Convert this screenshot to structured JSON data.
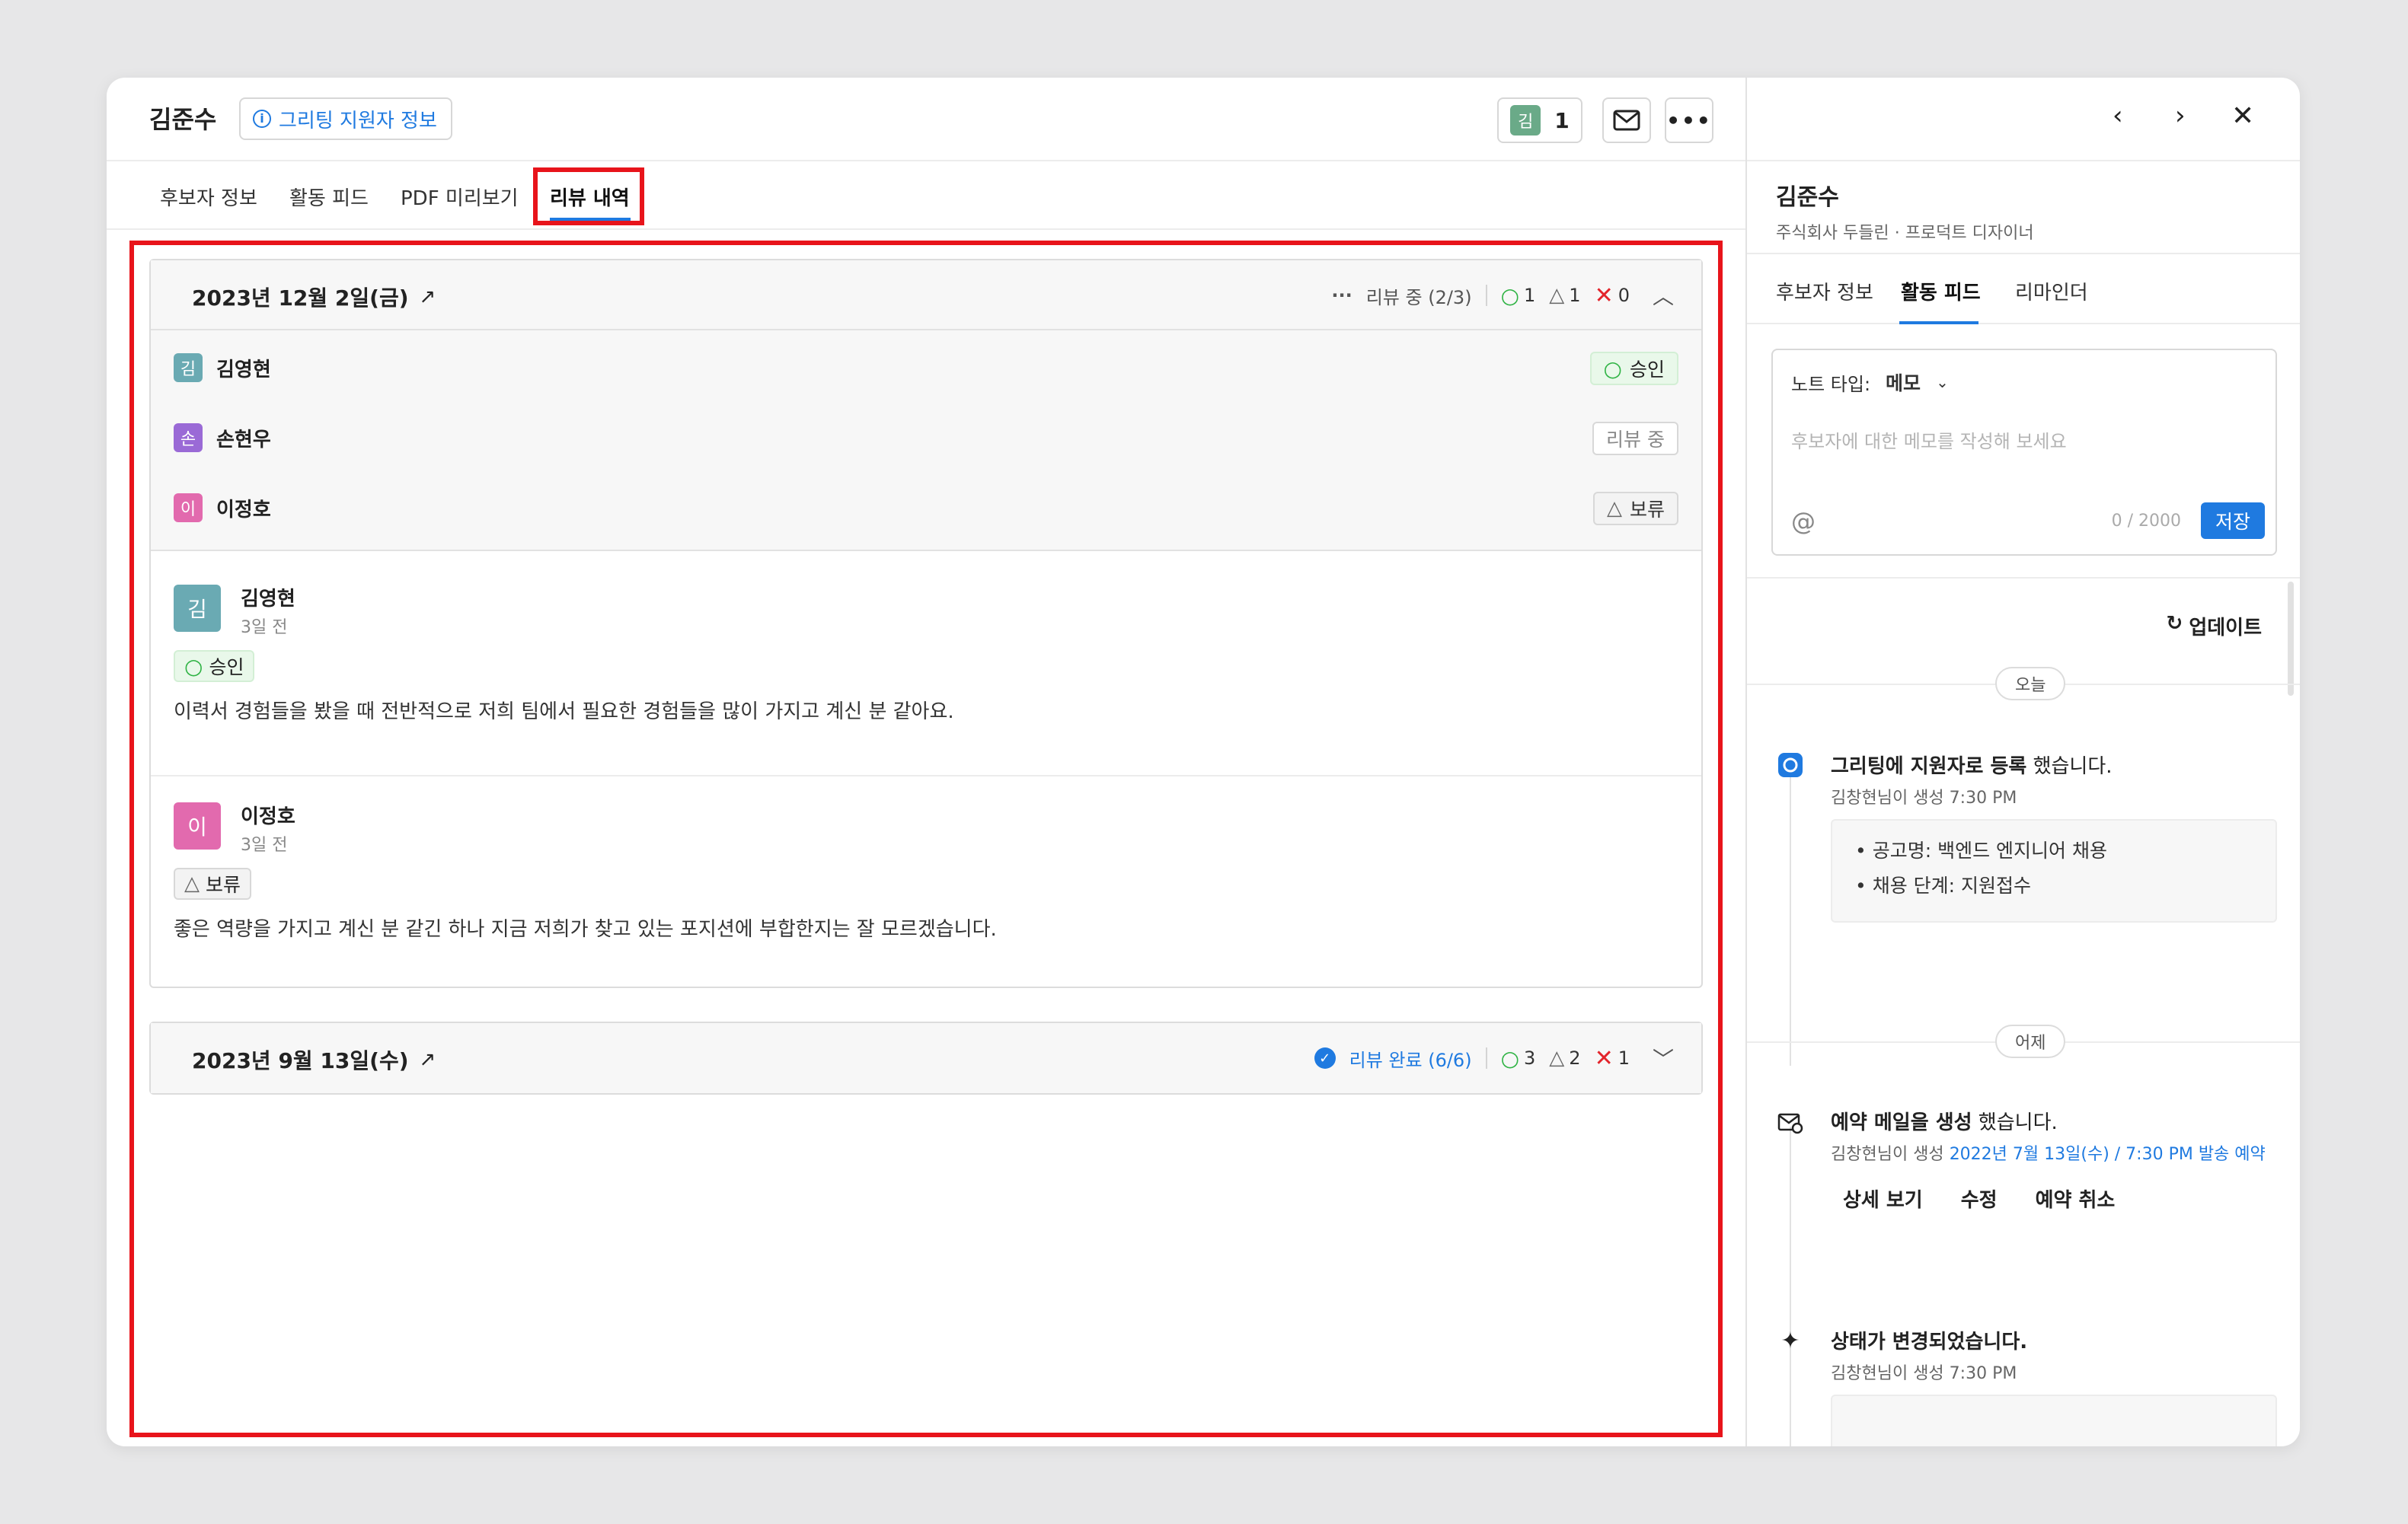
{
  "header": {
    "candidate_name": "김준수",
    "info_chip_label": "그리팅 지원자 정보",
    "counter_avatar": "김",
    "counter_value": "1"
  },
  "tabs": [
    "후보자 정보",
    "활동 피드",
    "PDF 미리보기",
    "리뷰 내역"
  ],
  "active_tab": "리뷰 내역",
  "reviews": [
    {
      "date": "2023년 12월 2일(금)",
      "status": "리뷰 중 (2/3)",
      "approve": "1",
      "hold": "1",
      "reject": "0",
      "reviewers": [
        {
          "initial": "김",
          "name": "김영현",
          "color": "#6aaab3",
          "badge": "승인"
        },
        {
          "initial": "손",
          "name": "손현우",
          "color": "#9a6ad6",
          "badge": "리뷰 중"
        },
        {
          "initial": "이",
          "name": "이정호",
          "color": "#e26aae",
          "badge": "보류"
        }
      ],
      "comments": [
        {
          "initial": "김",
          "name": "김영현",
          "time": "3일 전",
          "badge": "승인",
          "text": "이력서 경험들을 봤을 때 전반적으로 저희 팀에서 필요한 경험들을 많이 가지고 계신 분 같아요."
        },
        {
          "initial": "이",
          "name": "이정호",
          "time": "3일 전",
          "badge": "보류",
          "text": "좋은 역량을 가지고 계신 분 같긴 하나 지금 저희가 찾고 있는 포지션에 부합한지는 잘 모르겠습니다."
        }
      ]
    },
    {
      "date": "2023년 9월 13일(수)",
      "status": "리뷰 완료 (6/6)",
      "approve": "3",
      "hold": "2",
      "reject": "1"
    }
  ],
  "side": {
    "name": "김준수",
    "company": "주식회사 두들린",
    "role": "프로덕트 디자이너",
    "tabs": [
      "후보자 정보",
      "활동 피드",
      "리마인더"
    ],
    "active_tab": "활동 피드",
    "note": {
      "type_label": "노트 타입:",
      "type_value": "메모",
      "placeholder": "후보자에 대한 메모를 작성해 보세요",
      "counter": "0 / 2000",
      "save_label": "저장"
    },
    "update_label": "업데이트",
    "feed": [
      {
        "day": "오늘",
        "title_bold": "그리팅에 지원자로 등록",
        "title_rest": " 했습니다.",
        "meta": "김창현님이 생성 7:30 PM",
        "details": [
          "• 공고명: 백엔드 엔지니어 채용",
          "• 채용 단계: 지원접수"
        ]
      },
      {
        "day": "어제",
        "title_bold": "예약 메일을 생성",
        "title_rest": " 했습니다.",
        "meta": "김창현님이 생성",
        "meta_link": "2022년 7월 13일(수) / 7:30 PM 발송 예약",
        "actions": [
          "상세 보기",
          "수정",
          "예약 취소"
        ]
      },
      {
        "title_bold": "상태가 변경되었습니다.",
        "title_rest": "",
        "meta": "김창현님이 생성 7:30 PM"
      }
    ]
  }
}
